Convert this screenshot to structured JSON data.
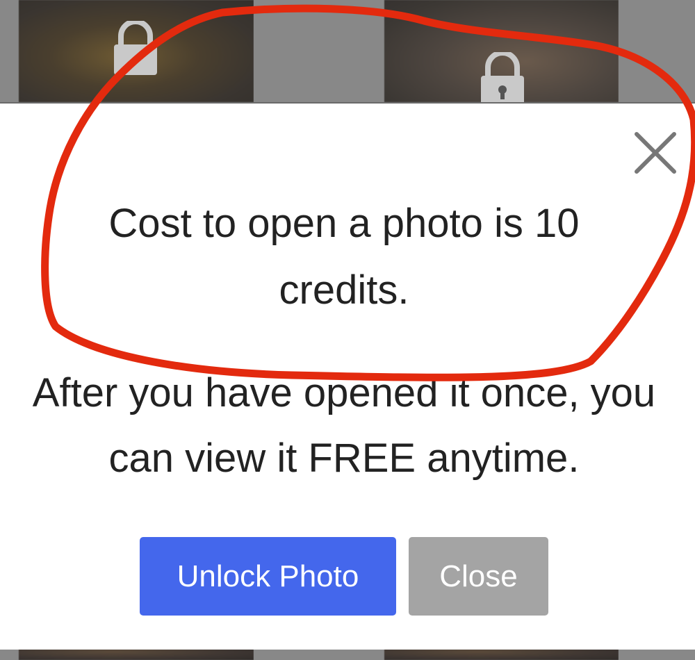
{
  "background": {
    "thumbnails": [
      {
        "icon": "lock-icon"
      },
      {
        "icon": "lock-icon"
      },
      {
        "icon": ""
      },
      {
        "icon": ""
      }
    ]
  },
  "modal": {
    "close_icon": "close-icon",
    "cost_message": "Cost to open a photo is 10 credits.",
    "info_message": "After you have opened it once, you can view it FREE anytime.",
    "unlock_button_label": "Unlock Photo",
    "close_button_label": "Close",
    "colors": {
      "unlock_button": "#4467ec",
      "close_button": "#a4a4a4",
      "text": "#222222"
    }
  },
  "annotation": {
    "type": "hand-drawn red circle around cost message",
    "color": "#e32a0e"
  }
}
